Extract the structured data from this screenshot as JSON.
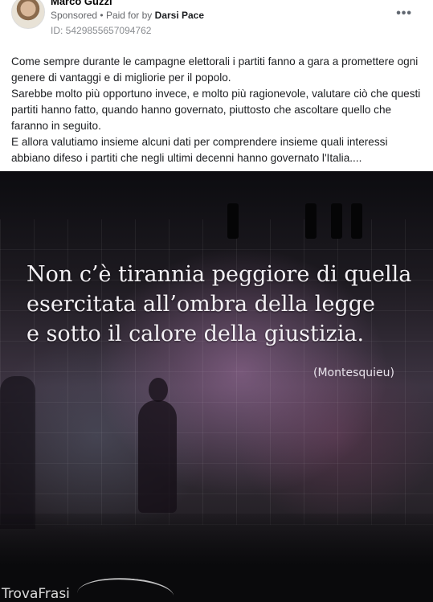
{
  "post": {
    "author": "Marco Guzzi",
    "sponsored_label": "Sponsored",
    "separator": "•",
    "paid_for_prefix": "Paid for by",
    "paid_for_name": "Darsi Pace",
    "ad_id": "ID: 5429855657094762",
    "more_icon": "more-horizontal-icon",
    "body_paragraphs": [
      "Come sempre durante le campagne elettorali i partiti fanno a gara a promettere ogni genere di vantaggi e di migliorie per il popolo.",
      "Sarebbe molto più opportuno invece, e molto più ragionevole, valutare ciò che questi partiti hanno fatto, quando hanno governato, piuttosto che ascoltare quello che faranno in seguito.",
      "E allora valutiamo insieme alcuni dati per comprendere insieme quali interessi abbiano difeso i partiti che negli ultimi decenni hanno governato l'Italia...."
    ]
  },
  "media": {
    "quote_lines": [
      "Non c’è tirannia peggiore di quella",
      "esercitata all’ombra della legge",
      "e sotto il calore della giustizia."
    ],
    "attribution": "(Montesquieu)",
    "watermark": "TrovaFrasi"
  }
}
